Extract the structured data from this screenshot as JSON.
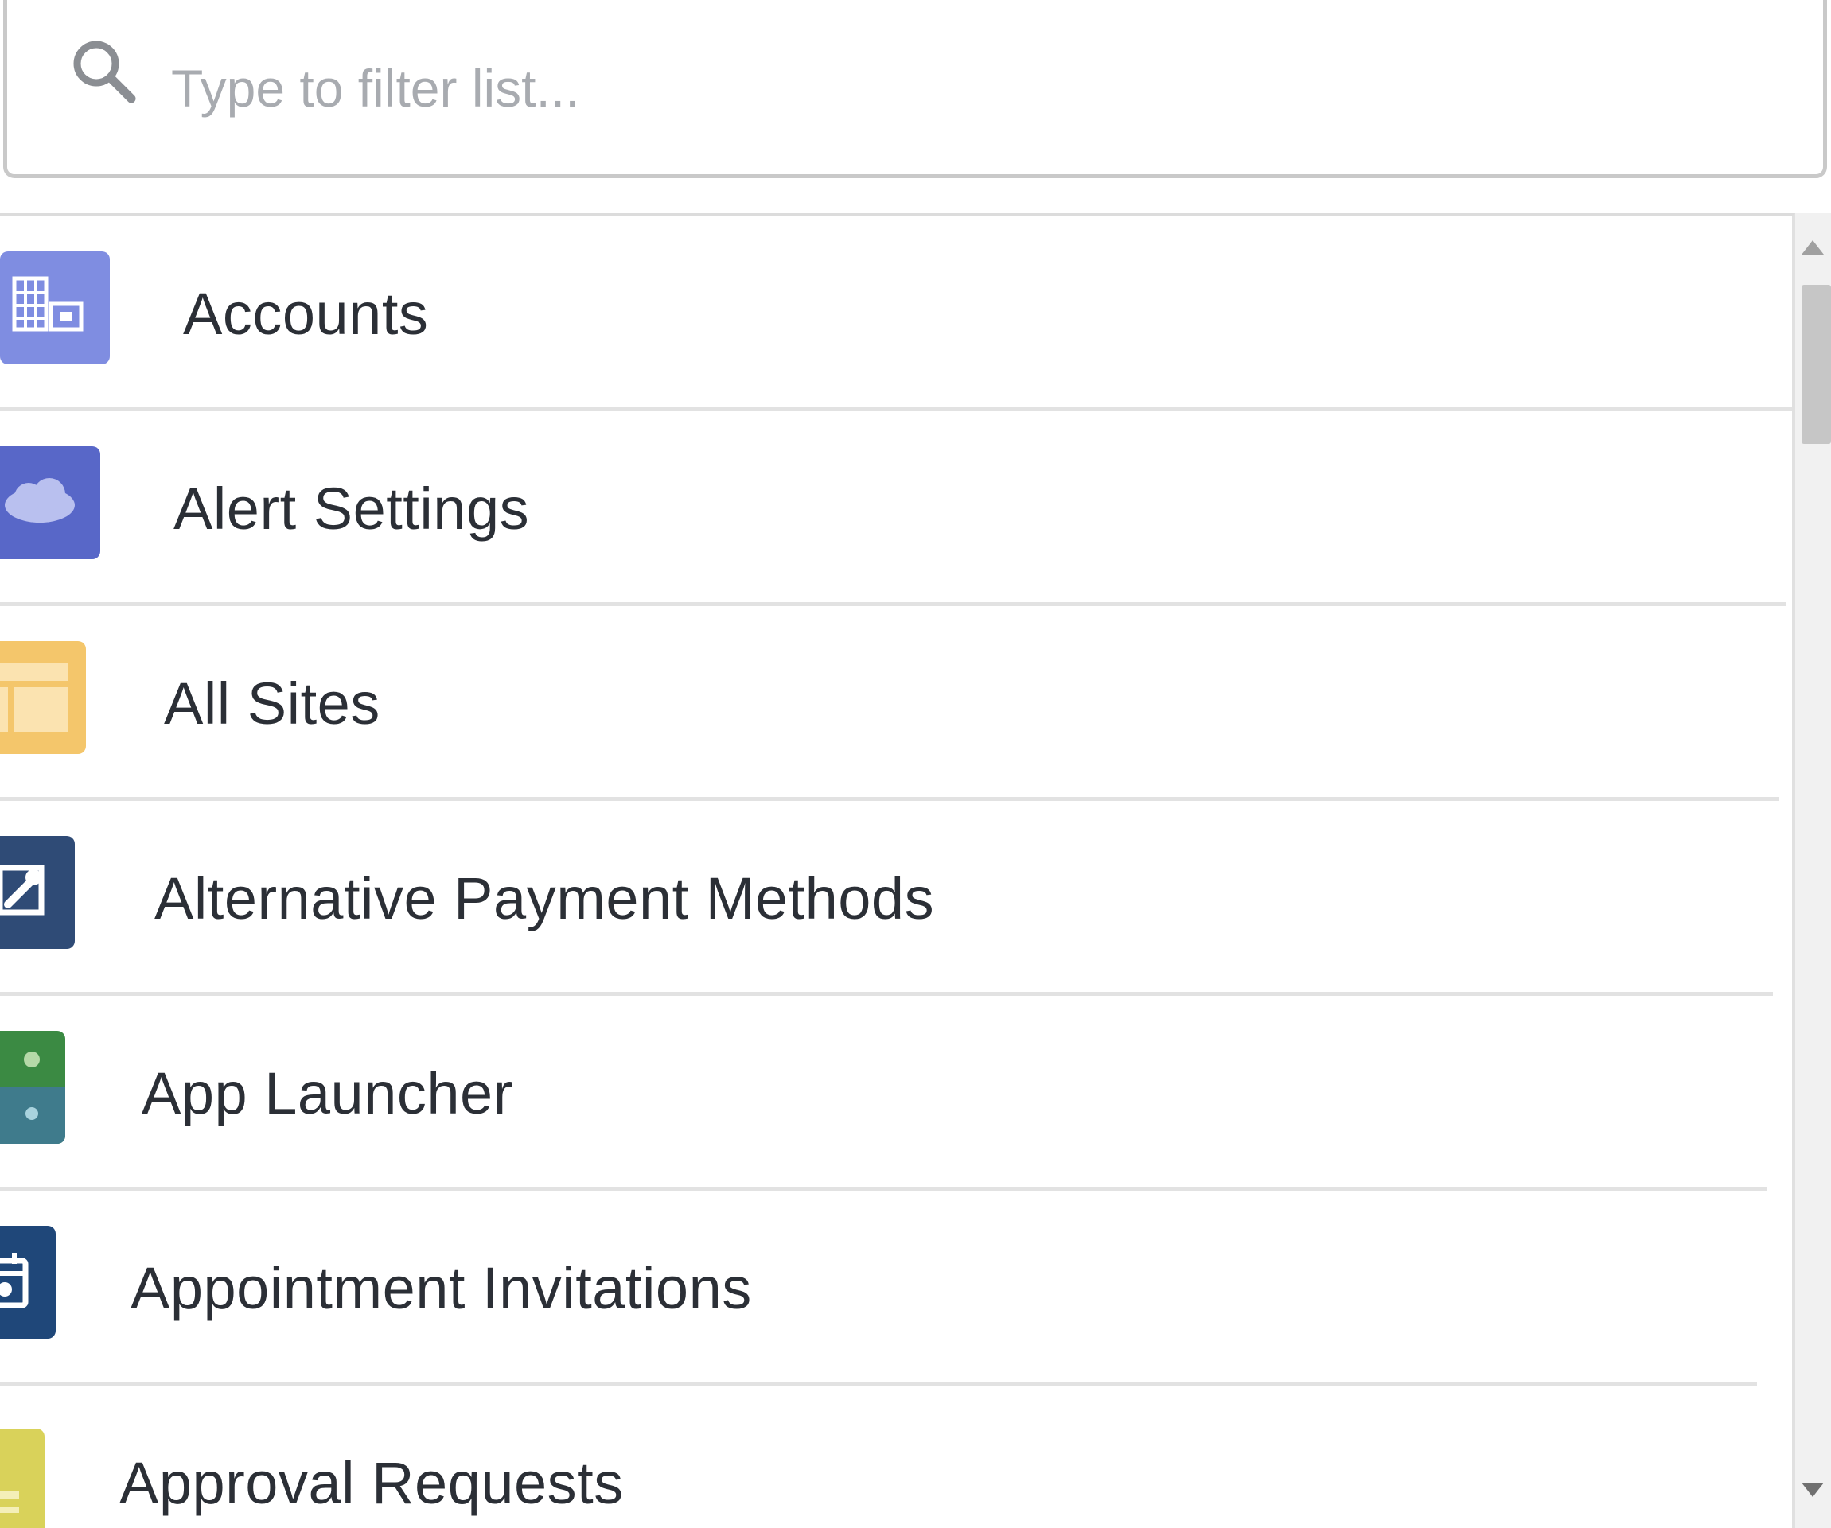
{
  "search": {
    "placeholder": "Type to filter list...",
    "value": ""
  },
  "list": {
    "items": [
      {
        "label": "Accounts",
        "icon": "accounts-icon",
        "color": "#7f8de1"
      },
      {
        "label": "Alert Settings",
        "icon": "cloud-icon",
        "color": "#5867c8"
      },
      {
        "label": "All Sites",
        "icon": "sites-icon",
        "color": "#f4c66b"
      },
      {
        "label": "Alternative Payment Methods",
        "icon": "payment-tools-icon",
        "color": "#2f4b76"
      },
      {
        "label": "App Launcher",
        "icon": "app-launcher-icon",
        "color": "#3b8a43"
      },
      {
        "label": "Appointment Invitations",
        "icon": "calendar-icon",
        "color": "#1f4779"
      },
      {
        "label": "Approval Requests",
        "icon": "approval-icon",
        "color": "#d9d25a"
      }
    ]
  },
  "colors": {
    "border": "#c9c9c9",
    "divider": "#e2e2e2",
    "text": "#2b2f36",
    "placeholder": "#a8abb0",
    "scroll_thumb": "#c6c6c6"
  }
}
